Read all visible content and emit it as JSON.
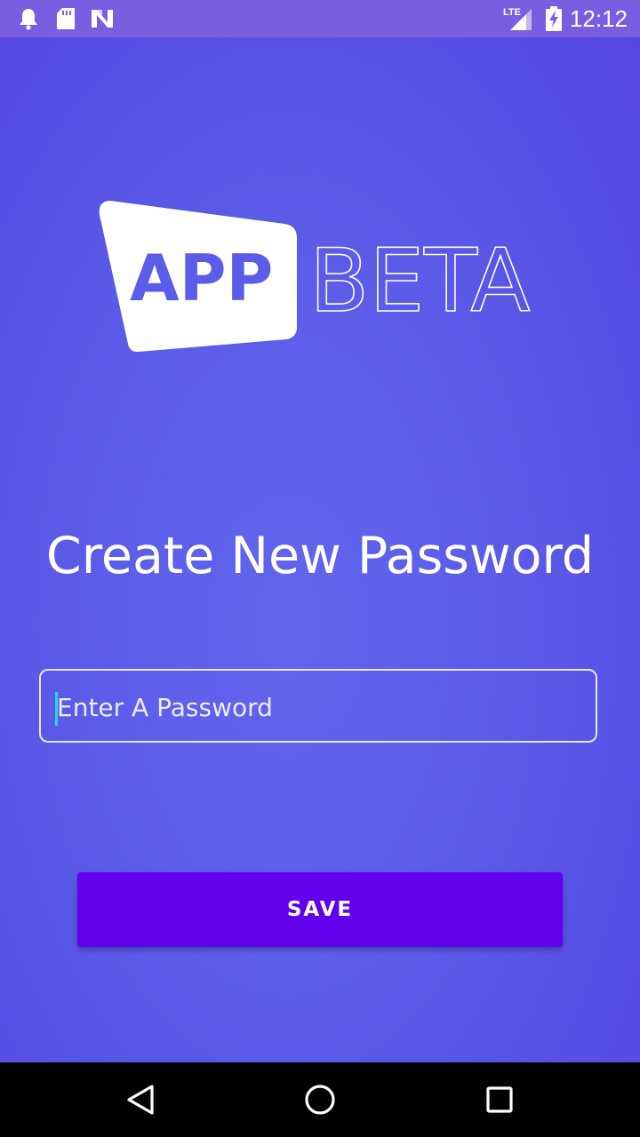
{
  "status_bar": {
    "time": "12:12",
    "network": "LTE",
    "icons": [
      "notification-bell-icon",
      "sd-card-icon",
      "n-logo-icon",
      "lte-signal-icon",
      "battery-charging-icon"
    ]
  },
  "logo": {
    "app_text": "APP",
    "beta_text": "BETA"
  },
  "title": "Create New Password",
  "password_input": {
    "placeholder": "Enter A Password",
    "value": ""
  },
  "save_button": {
    "label": "SAVE"
  },
  "colors": {
    "background": "#5a5ce8",
    "status_bar": "#7a5ee2",
    "button": "#6200ee",
    "cursor": "#2ad3e8"
  },
  "nav_bar": {
    "buttons": [
      "back-icon",
      "home-icon",
      "recents-icon"
    ]
  }
}
